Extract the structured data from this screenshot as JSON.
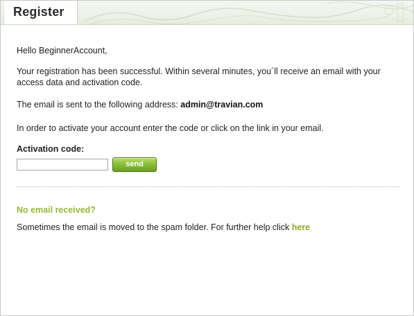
{
  "dialog": {
    "title": "Register"
  },
  "message": {
    "greeting": "Hello BeginnerAccount,",
    "success": "Your registration has been successful. Within several minutes, you´ll receive an email with your access data and activation code.",
    "email_prefix": "The email is sent to the following address:",
    "email_address": "admin@travian.com",
    "activate_instructions": "In order to activate your account enter the code or click on the link in your email."
  },
  "activation": {
    "label": "Activation code:",
    "input_value": "",
    "send_label": "send"
  },
  "no_email": {
    "heading": "No email received?",
    "text": "Sometimes the email is moved to the spam folder. For further help click",
    "link_label": "here"
  },
  "colors": {
    "accent_green": "#99b83a",
    "button_green": "#6b9f1f"
  }
}
